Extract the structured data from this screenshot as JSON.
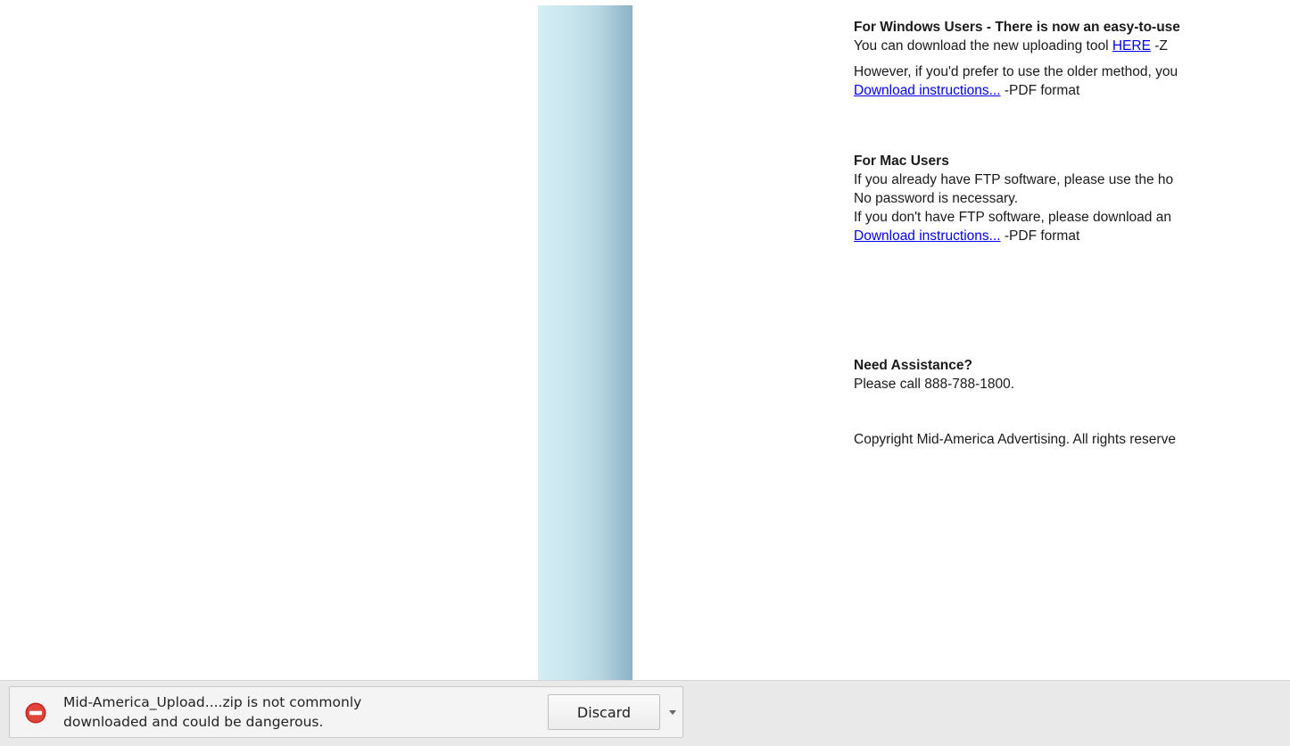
{
  "page": {
    "windows_heading": "For Windows Users - There is now an easy-to-use",
    "windows_download_prefix": "You can download the new uploading tool ",
    "windows_download_link": "HERE",
    "windows_download_suffix": " -Z",
    "older_method_text": "However, if you'd prefer to use the older method, you",
    "download_instructions_link_1": "Download instructions...",
    "pdf_format_1": " -PDF format",
    "mac_heading": "For Mac Users",
    "mac_line_1": "If you already have FTP software, please use the ho",
    "mac_line_2": "No password is necessary.",
    "mac_line_3": "If you don't have FTP software, please download an",
    "download_instructions_link_2": "Download instructions...",
    "pdf_format_2": " -PDF format",
    "assistance_heading": "Need Assistance?",
    "assistance_text": "Please call 888-788-1800.",
    "copyright": "Copyright Mid-America Advertising. All rights reserve"
  },
  "download_bar": {
    "warning_line_1": "Mid-America_Upload....zip is not commonly",
    "warning_line_2": "downloaded and could be dangerous.",
    "discard_label": "Discard",
    "icon": "blocked-icon",
    "dropdown_icon": "chevron-down-icon"
  },
  "colors": {
    "link": "#0000ee",
    "warning_icon": "#d9322b",
    "download_bar_bg": "#e9e9e9"
  }
}
